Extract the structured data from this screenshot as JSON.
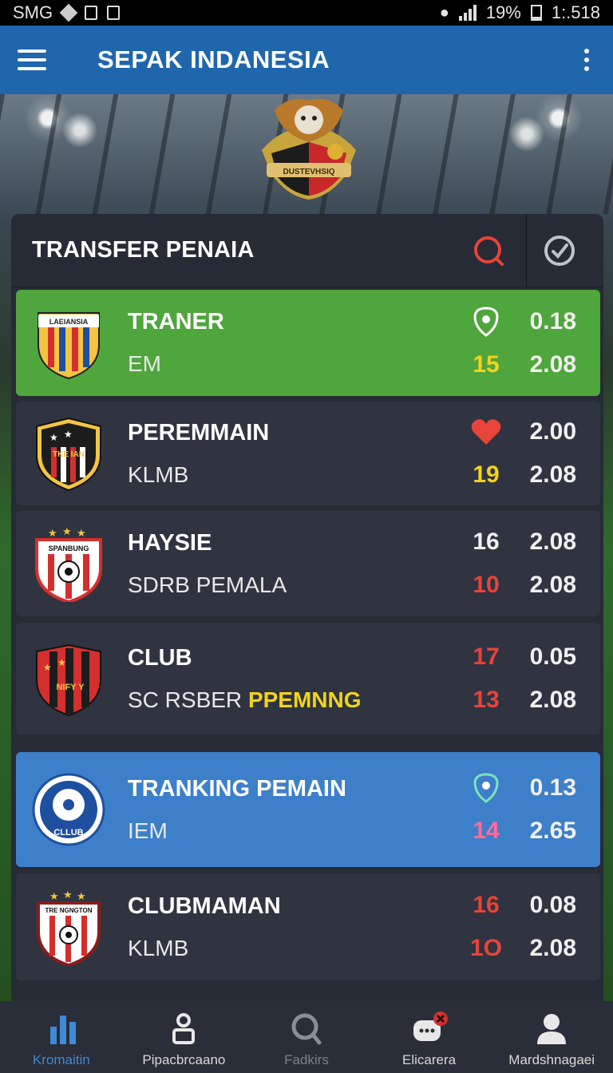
{
  "status_bar": {
    "carrier": "SMG",
    "battery": "19%",
    "time": "1:.518"
  },
  "app_bar": {
    "title": "SEPAK INDANESIA"
  },
  "panel": {
    "title": "TRANSFER PENAIA",
    "rows": [
      {
        "crest_text": "LAEIANSIA",
        "name": "TRANER",
        "sub": "EM",
        "sub_highlight": "",
        "stat1_a": "",
        "stat1_a_icon": "shield-icon",
        "stat1_b": "0.18",
        "stat2_a": "15",
        "stat2_b": "2.08",
        "style": "green"
      },
      {
        "crest_text": "TKE IAN",
        "name": "PEREMMAIN",
        "sub": "KLMB",
        "sub_highlight": "",
        "stat1_a": "",
        "stat1_a_icon": "heart-icon",
        "stat1_b": "2.00",
        "stat2_a": "19",
        "stat2_b": "2.08",
        "style": "dark"
      },
      {
        "crest_text": "SPANBUNG",
        "name": "HAYSIE",
        "sub": "SDRB PEMALA",
        "sub_highlight": "",
        "stat1_a": "16",
        "stat1_b": "2.08",
        "stat2_a": "10",
        "stat2_b": "2.08",
        "style": "dark"
      },
      {
        "crest_text": "NIFY Y",
        "name": "CLUB",
        "sub": "SC RSBER",
        "sub_highlight": "PPEMNNG",
        "stat1_a": "17",
        "stat1_b": "0.05",
        "stat2_a": "13",
        "stat2_b": "2.08",
        "style": "dark"
      },
      {
        "crest_text": "CLLUB",
        "name": "TRANKING PEMAIN",
        "sub": "IEM",
        "sub_highlight": "",
        "stat1_a": "",
        "stat1_a_icon": "shield-icon",
        "stat1_b": "0.13",
        "stat2_a": "14",
        "stat2_b": "2.65",
        "style": "blue"
      },
      {
        "crest_text": "TRE NGNGTON",
        "name": "CLUBMAMAN",
        "sub": "KLMB",
        "sub_highlight": "",
        "stat1_a": "16",
        "stat1_b": "0.08",
        "stat2_a": "1O",
        "stat2_b": "2.08",
        "style": "dark"
      }
    ]
  },
  "top_crest_text": "DUSTEVHSIQ",
  "bottom_nav": [
    {
      "label": "Kromaitin",
      "icon": "stats-icon",
      "state": "active"
    },
    {
      "label": "Pipacbrcaano",
      "icon": "trophy-icon",
      "state": "normal"
    },
    {
      "label": "Fadkirs",
      "icon": "search-icon",
      "state": "dim"
    },
    {
      "label": "Elicarera",
      "icon": "chat-icon",
      "state": "normal"
    },
    {
      "label": "Mardshnagaei",
      "icon": "profile-icon",
      "state": "normal"
    }
  ],
  "colors": {
    "app_bar": "#1f66ad",
    "row_green": "#4fa63c",
    "row_blue": "#3d7fc9",
    "accent_yellow": "#f2d31c",
    "accent_red": "#e8443a"
  }
}
